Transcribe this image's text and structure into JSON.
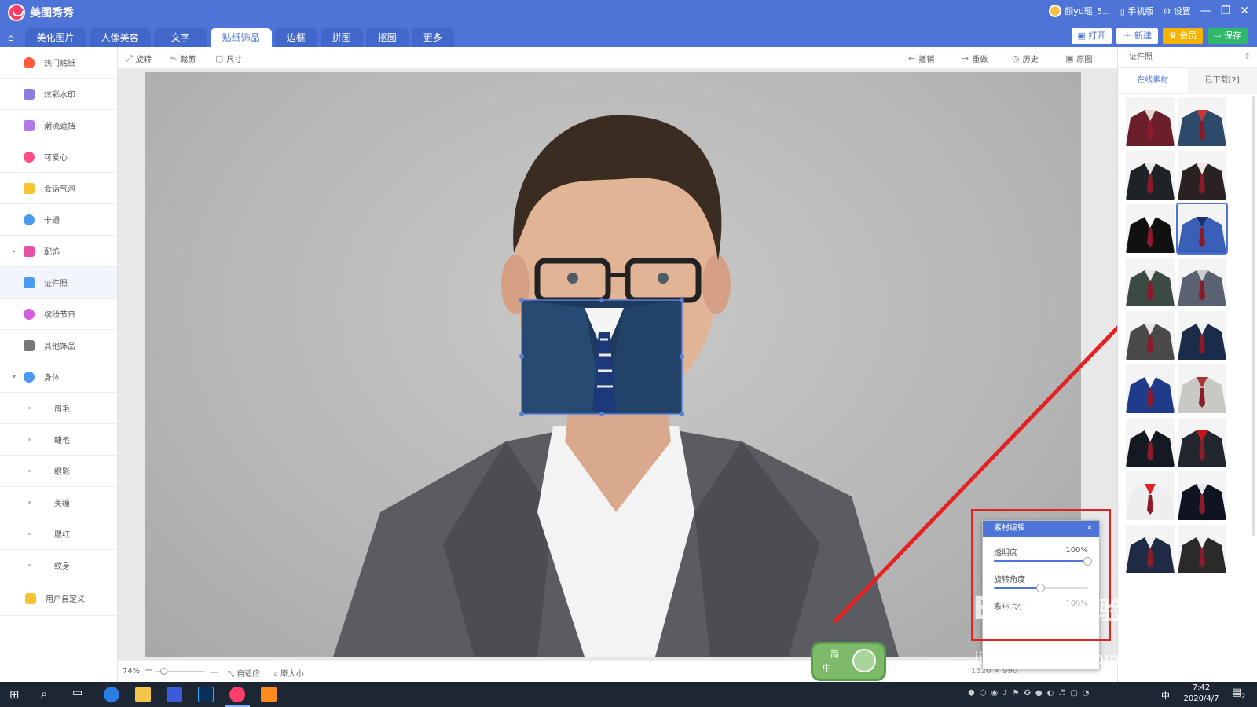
{
  "app": {
    "title": "美图秀秀"
  },
  "topbar": {
    "user": "颜yu瑶_5...",
    "mobile": "手机版",
    "settings": "设置"
  },
  "tabs": [
    {
      "label": "美化图片"
    },
    {
      "label": "人像美容"
    },
    {
      "label": "文字"
    },
    {
      "label": "贴纸饰品",
      "active": true
    },
    {
      "label": "边框"
    },
    {
      "label": "拼图"
    },
    {
      "label": "抠图"
    },
    {
      "label": "更多"
    }
  ],
  "actions": {
    "open": "打开",
    "new": "新建",
    "vip": "会员",
    "save": "保存"
  },
  "sidebar": {
    "items": [
      {
        "label": "热门贴纸",
        "color": "#ff5a3c"
      },
      {
        "label": "炫彩水印",
        "color": "#8f7ce0"
      },
      {
        "label": "潮流遮挡",
        "color": "#b279e8"
      },
      {
        "label": "可爱心",
        "color": "#ff4d8a"
      },
      {
        "label": "会话气泡",
        "color": "#f5c531"
      },
      {
        "label": "卡通",
        "color": "#4a9bf0"
      },
      {
        "label": "配饰",
        "color": "#e94fa6"
      },
      {
        "label": "证件照",
        "color": "#4a9bf0"
      },
      {
        "label": "缤纷节日",
        "color": "#d15fe0"
      },
      {
        "label": "其他饰品",
        "color": "#777777"
      },
      {
        "label": "身体",
        "color": "#4a9bf0"
      }
    ],
    "subitems": [
      {
        "label": "眉毛"
      },
      {
        "label": "睫毛"
      },
      {
        "label": "眼影"
      },
      {
        "label": "美瞳"
      },
      {
        "label": "腮红"
      },
      {
        "label": "纹身"
      }
    ],
    "custom": {
      "label": "用户自定义",
      "color": "#f5c531"
    }
  },
  "toolbar": {
    "rotate": "旋转",
    "crop": "裁剪",
    "size": "尺寸",
    "undo": "撤销",
    "redo": "重做",
    "history": "历史",
    "original": "原图"
  },
  "status": {
    "zoom": "74%",
    "fit": "自适应",
    "actual": "原大小",
    "dims": "1320 × 990"
  },
  "rightpanel": {
    "dropdown": "证件照",
    "tab_online": "在线素材",
    "tab_downloaded": "已下载[2]"
  },
  "dialog": {
    "title": "素材编辑",
    "opacity_label": "透明度",
    "opacity_value": "100%",
    "opacity": 1.0,
    "rotation_label": "旋转角度",
    "rotation": 0.5,
    "size_label": "素材大小",
    "size_value": "100%"
  },
  "lang": {
    "a": "简",
    "b": "中"
  },
  "taskbar": {
    "time": "7:42",
    "date": "2020/4/7",
    "ime": "中",
    "notify": "2"
  },
  "watermark": {
    "brand": "Baidu",
    "text": "经验",
    "url": "jingyan.baidu.com"
  }
}
